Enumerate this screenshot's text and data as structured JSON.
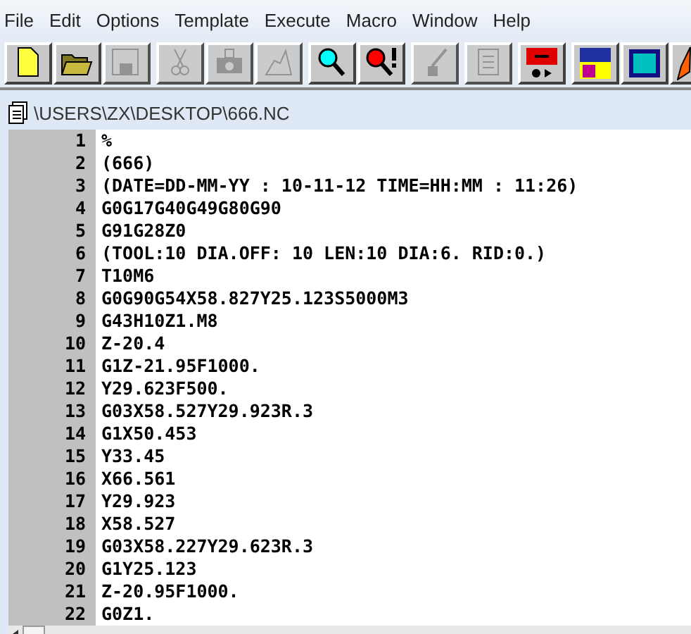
{
  "menu": [
    "File",
    "Edit",
    "Options",
    "Template",
    "Execute",
    "Macro",
    "Window",
    "Help"
  ],
  "toolbar": [
    [
      {
        "disabled": false
      },
      {
        "disabled": false
      },
      {
        "disabled": true
      }
    ],
    [
      {
        "disabled": true
      },
      {
        "disabled": true
      },
      {
        "disabled": true
      }
    ],
    [
      {
        "disabled": false
      },
      {
        "disabled": false
      }
    ],
    [
      {
        "disabled": true
      }
    ],
    [
      {
        "disabled": true
      }
    ],
    [
      {
        "disabled": false
      }
    ],
    [
      {
        "disabled": false
      },
      {
        "disabled": false
      },
      {
        "disabled": false
      }
    ]
  ],
  "document": {
    "path": "\\USERS\\ZX\\DESKTOP\\666.NC",
    "lines": [
      {
        "number": "1",
        "code": "%"
      },
      {
        "number": "2",
        "code": "(666)"
      },
      {
        "number": "3",
        "code": "(DATE=DD-MM-YY : 10-11-12 TIME=HH:MM : 11:26)"
      },
      {
        "number": "4",
        "code": "G0G17G40G49G80G90"
      },
      {
        "number": "5",
        "code": "G91G28Z0"
      },
      {
        "number": "6",
        "code": "(TOOL:10 DIA.OFF: 10 LEN:10 DIA:6. RID:0.)"
      },
      {
        "number": "7",
        "code": "T10M6"
      },
      {
        "number": "8",
        "code": "G0G90G54X58.827Y25.123S5000M3"
      },
      {
        "number": "9",
        "code": "G43H10Z1.M8"
      },
      {
        "number": "10",
        "code": "Z-20.4"
      },
      {
        "number": "11",
        "code": "G1Z-21.95F1000."
      },
      {
        "number": "12",
        "code": "Y29.623F500."
      },
      {
        "number": "13",
        "code": "G03X58.527Y29.923R.3"
      },
      {
        "number": "14",
        "code": "G1X50.453"
      },
      {
        "number": "15",
        "code": "Y33.45"
      },
      {
        "number": "16",
        "code": "X66.561"
      },
      {
        "number": "17",
        "code": "Y29.923"
      },
      {
        "number": "18",
        "code": "X58.527"
      },
      {
        "number": "19",
        "code": "G03X58.227Y29.623R.3"
      },
      {
        "number": "20",
        "code": "G1Y25.123"
      },
      {
        "number": "21",
        "code": "Z-20.95F1000."
      },
      {
        "number": "22",
        "code": "G0Z1."
      }
    ]
  }
}
